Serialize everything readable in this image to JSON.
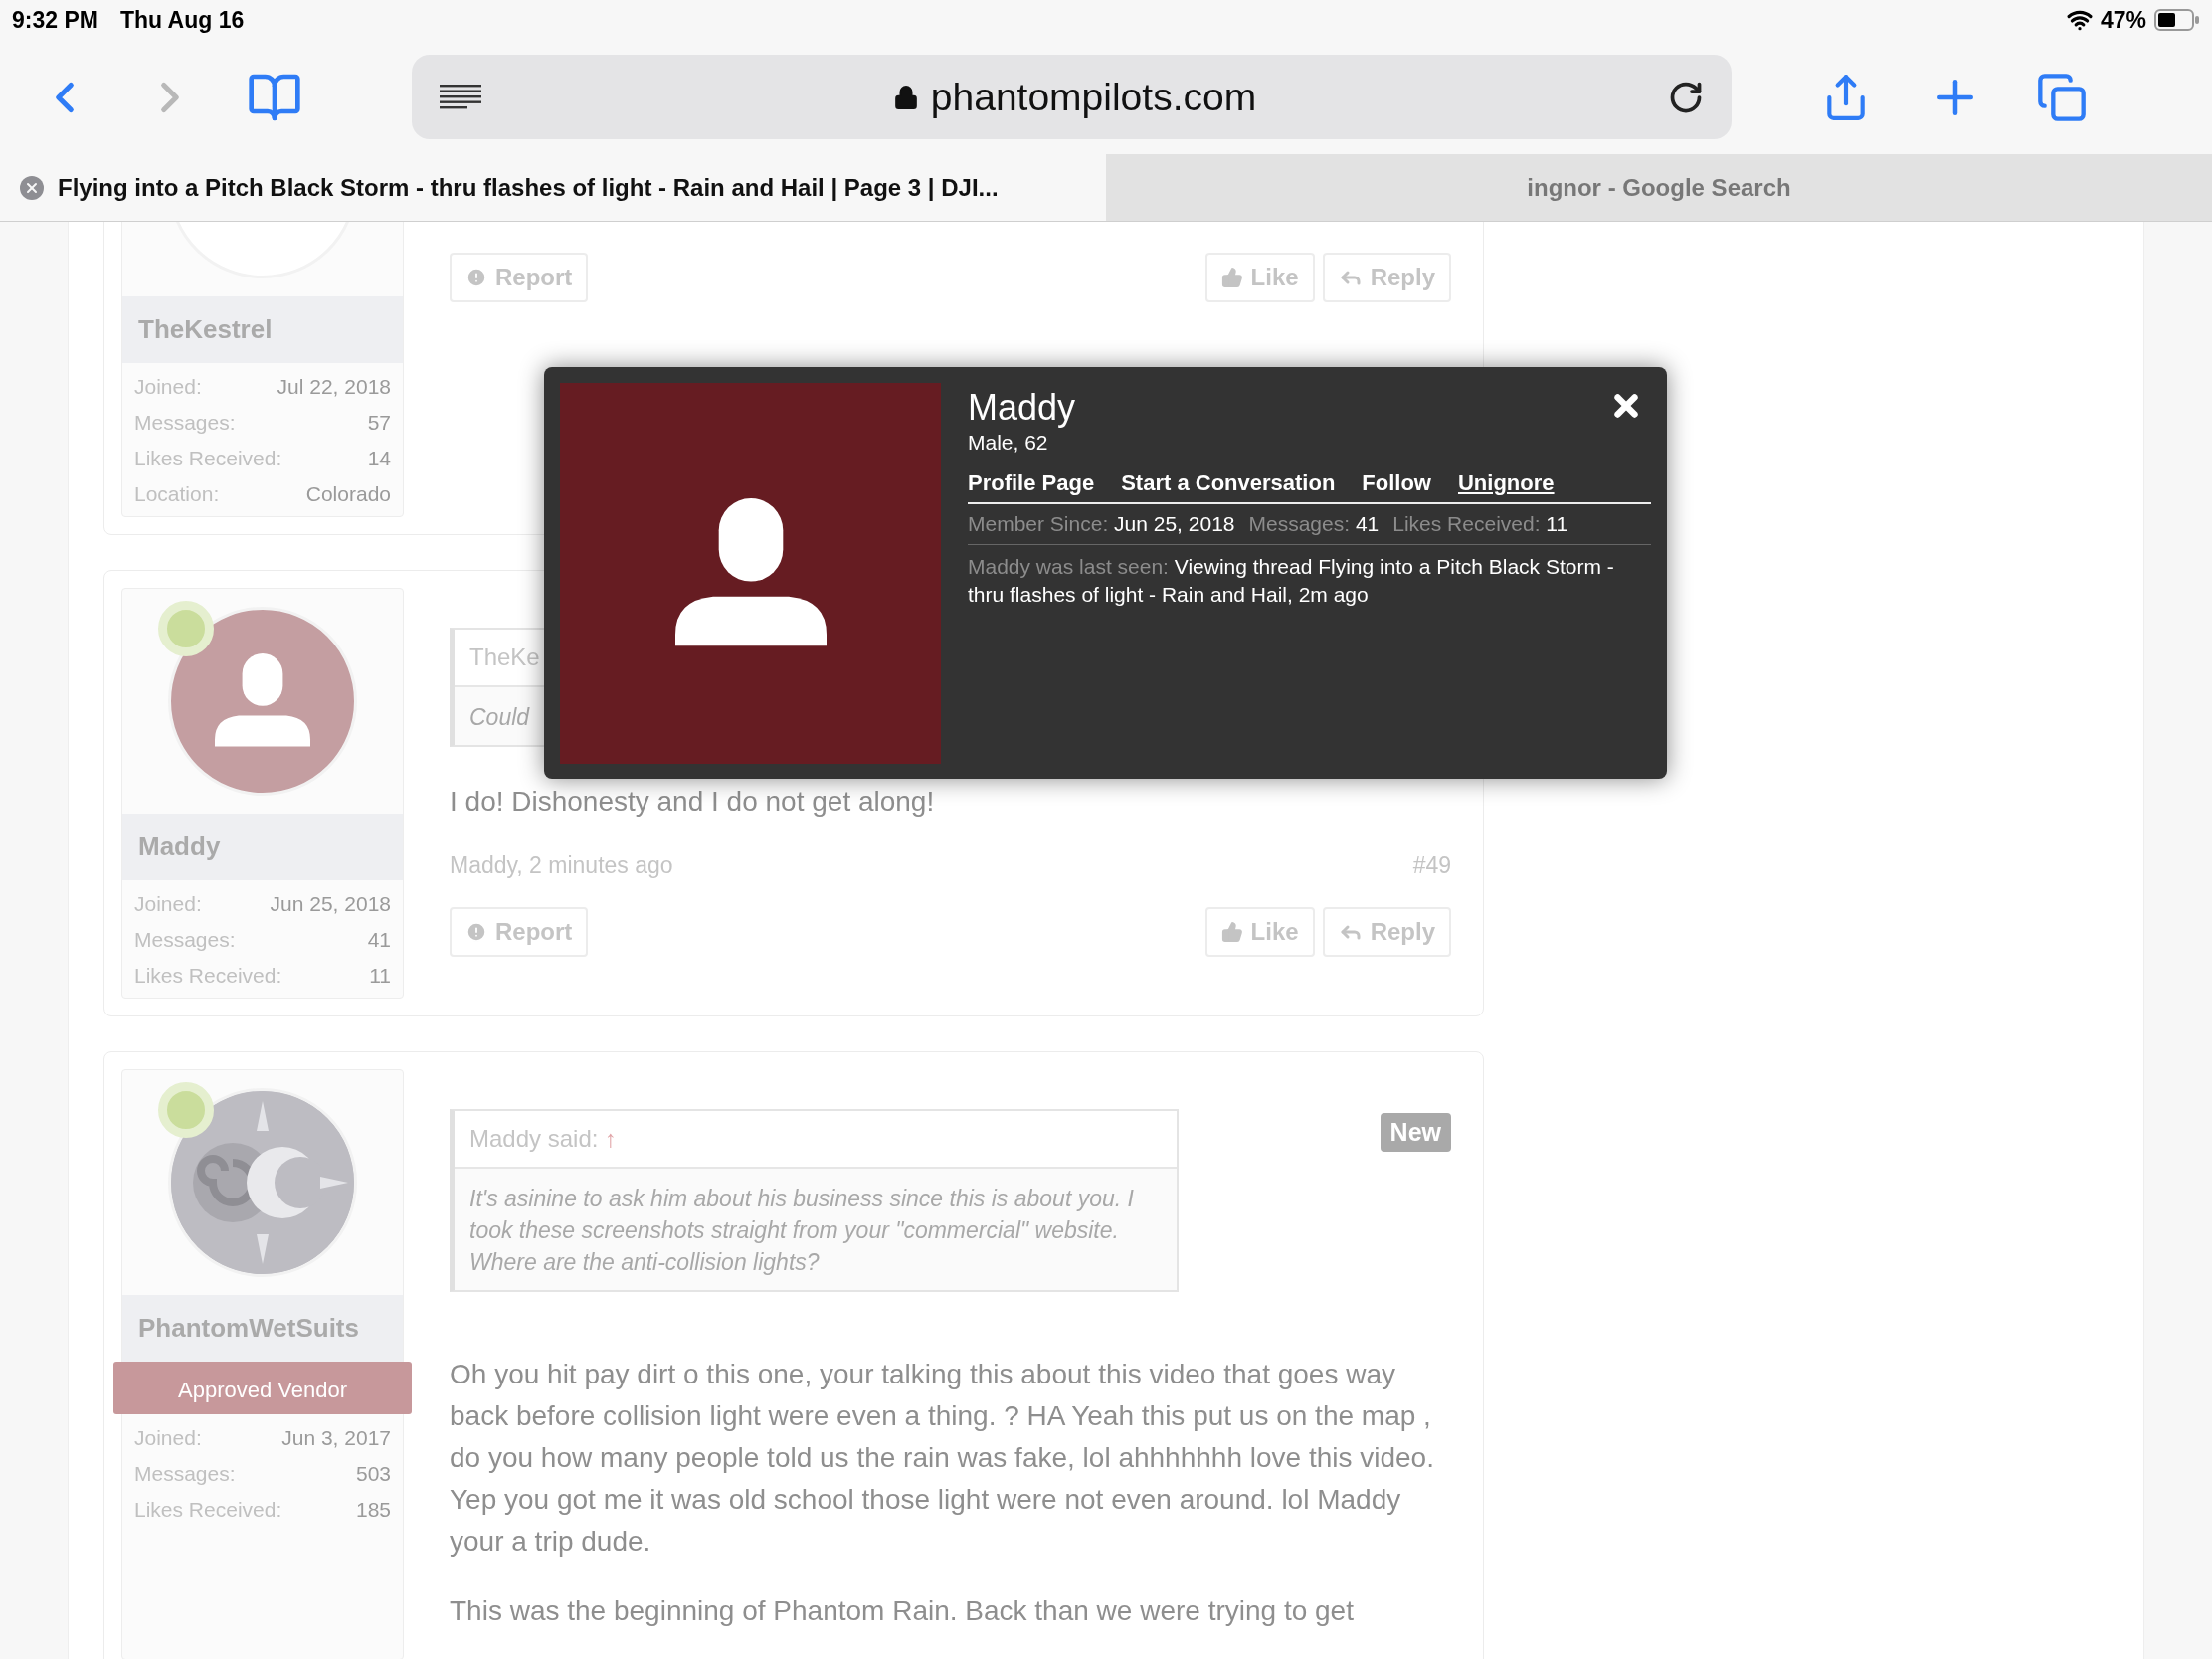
{
  "status_bar": {
    "time": "9:32 PM",
    "date": "Thu Aug 16",
    "battery": "47%"
  },
  "toolbar": {
    "url": "phantompilots.com"
  },
  "tabs": [
    {
      "title": "Flying into a Pitch Black Storm - thru flashes of light - Rain and Hail | Page 3 | DJI...",
      "selected": true
    },
    {
      "title": "ingnor - Google Search",
      "selected": false
    }
  ],
  "posts": [
    {
      "author": "TheKestrel",
      "avatar": {
        "kind": "blank"
      },
      "stats": [
        {
          "label": "Joined:",
          "value": "Jul 22, 2018"
        },
        {
          "label": "Messages:",
          "value": "57"
        },
        {
          "label": "Likes Received:",
          "value": "14"
        },
        {
          "label": "Location:",
          "value": "Colorado"
        }
      ],
      "actions": {
        "report": "Report",
        "like": "Like",
        "reply": "Reply"
      }
    },
    {
      "author": "Maddy",
      "avatar": {
        "kind": "silhouette"
      },
      "online": true,
      "stats": [
        {
          "label": "Joined:",
          "value": "Jun 25, 2018"
        },
        {
          "label": "Messages:",
          "value": "41"
        },
        {
          "label": "Likes Received:",
          "value": "11"
        }
      ],
      "quote": {
        "author": "TheKe",
        "text": "Could"
      },
      "message": [
        "I do! Dishonesty and I do not get along!"
      ],
      "meta": "Maddy, 2 minutes ago",
      "number": "#49",
      "actions": {
        "report": "Report",
        "like": "Like",
        "reply": "Reply"
      }
    },
    {
      "author": "PhantomWetSuits",
      "avatar": {
        "kind": "emblem"
      },
      "online": true,
      "banner": "Approved Vendor",
      "stats": [
        {
          "label": "Joined:",
          "value": "Jun 3, 2017"
        },
        {
          "label": "Messages:",
          "value": "503"
        },
        {
          "label": "Likes Received:",
          "value": "185"
        }
      ],
      "badge": "New",
      "quote": {
        "author": "Maddy said:",
        "arrow": "↑",
        "text": "It's asinine to ask him about his business since this is about you. I took these screenshots straight from your \"commercial\" website. Where are the anti-collision lights?"
      },
      "message": [
        "Oh you hit pay dirt o this one, your talking this about this video that goes way back before collision light were even a thing. ? HA Yeah this put us on the map , do you how many people told us the rain was fake, lol ahhhhhhh love this video. Yep you got me it was old school those light were not even around. lol Maddy your a trip dude.",
        "This was the beginning of Phantom Rain. Back than we were trying to get"
      ]
    }
  ],
  "popup": {
    "name": "Maddy",
    "subtitle": "Male, 62",
    "links": [
      {
        "label": "Profile Page",
        "underlined": false
      },
      {
        "label": "Start a Conversation",
        "underlined": false
      },
      {
        "label": "Follow",
        "underlined": false
      },
      {
        "label": "Unignore",
        "underlined": true
      }
    ],
    "stats": [
      {
        "label": "Member Since:",
        "value": "Jun 25, 2018"
      },
      {
        "label": "Messages:",
        "value": "41"
      },
      {
        "label": "Likes Received:",
        "value": "11"
      }
    ],
    "last_seen": {
      "label": "Maddy was last seen:",
      "value": "Viewing thread Flying into a Pitch Black Storm - thru flashes of light - Rain and Hail, 2m ago"
    }
  }
}
